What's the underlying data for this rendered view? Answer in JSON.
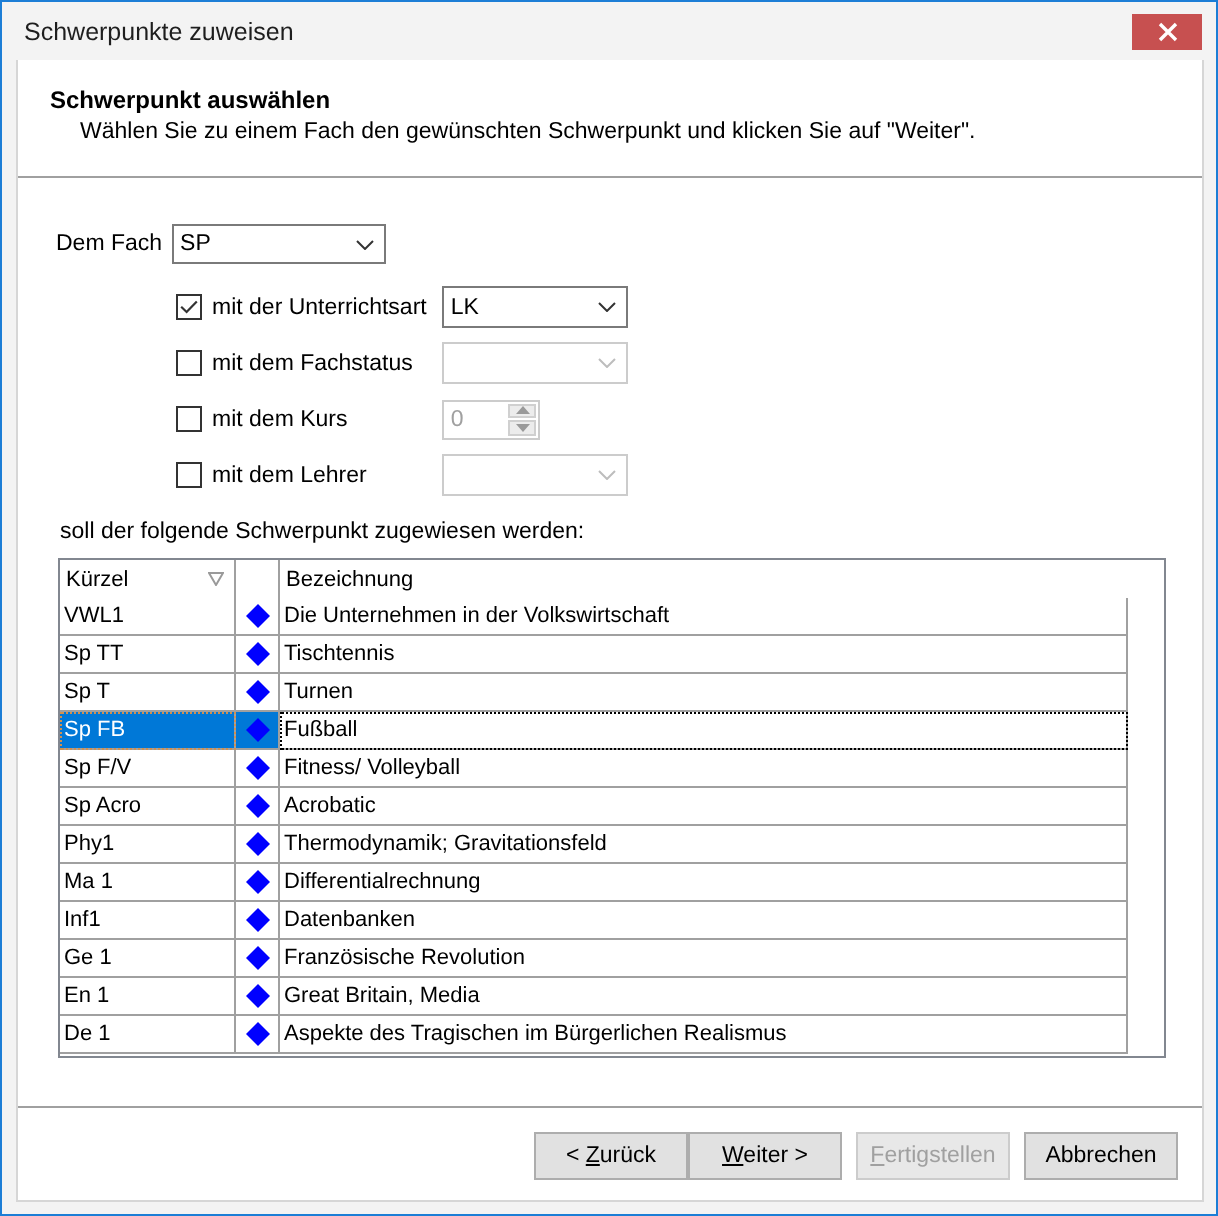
{
  "window": {
    "title": "Schwerpunkte zuweisen"
  },
  "header": {
    "title": "Schwerpunkt auswählen",
    "description": "Wählen Sie zu einem Fach den gewünschten Schwerpunkt und klicken Sie auf \"Weiter\"."
  },
  "subject": {
    "label": "Dem Fach",
    "value": "SP"
  },
  "filters": [
    {
      "kind": "dropdown",
      "label": "mit der Unterrichtsart",
      "checked": true,
      "disabled": false,
      "value": "LK"
    },
    {
      "kind": "dropdown",
      "label": "mit dem Fachstatus",
      "checked": false,
      "disabled": true
    },
    {
      "kind": "spinner",
      "label": "mit dem Kurs",
      "checked": false,
      "disabled": true,
      "value": "0"
    },
    {
      "kind": "dropdown",
      "label": "mit dem Lehrer",
      "checked": false,
      "disabled": true
    }
  ],
  "list_label": "soll der folgende Schwerpunkt zugewiesen werden:",
  "table": {
    "columns": [
      {
        "label": "Kürzel",
        "sort_indicator": true
      },
      {
        "label": "Bezeichnung",
        "sort_indicator": false
      }
    ],
    "rows": [
      {
        "code": "VWL1",
        "name": "Die Unternehmen in der Volkswirtschaft",
        "selected": false
      },
      {
        "code": "Sp TT",
        "name": "Tischtennis",
        "selected": false
      },
      {
        "code": "Sp T",
        "name": "Turnen",
        "selected": false
      },
      {
        "code": "Sp FB",
        "name": "Fußball",
        "selected": true
      },
      {
        "code": "Sp F/V",
        "name": "Fitness/ Volleyball",
        "selected": false
      },
      {
        "code": "Sp Acro",
        "name": "Acrobatic",
        "selected": false
      },
      {
        "code": "Phy1",
        "name": "Thermodynamik; Gravitationsfeld",
        "selected": false
      },
      {
        "code": "Ma 1",
        "name": "Differentialrechnung",
        "selected": false
      },
      {
        "code": "Inf1",
        "name": "Datenbanken",
        "selected": false
      },
      {
        "code": "Ge 1",
        "name": "Französische Revolution",
        "selected": false
      },
      {
        "code": "En 1",
        "name": "Great Britain, Media",
        "selected": false
      },
      {
        "code": "De 1",
        "name": "Aspekte des Tragischen im Bürgerlichen Realismus",
        "selected": false
      }
    ]
  },
  "buttons": [
    {
      "label": [
        {
          "text": "< ",
          "access_key": false
        },
        {
          "text": "Z",
          "access_key": true
        },
        {
          "text": "urück",
          "access_key": false
        }
      ],
      "disabled": false
    },
    {
      "label": [
        {
          "text": "W",
          "access_key": true
        },
        {
          "text": "eiter >",
          "access_key": false
        }
      ],
      "disabled": false
    },
    {
      "label": [
        {
          "text": "F",
          "access_key": true
        },
        {
          "text": "ertigstellen",
          "access_key": false
        }
      ],
      "disabled": true
    },
    {
      "label": [
        {
          "text": "Abbrechen",
          "access_key": false
        }
      ],
      "disabled": false
    }
  ]
}
